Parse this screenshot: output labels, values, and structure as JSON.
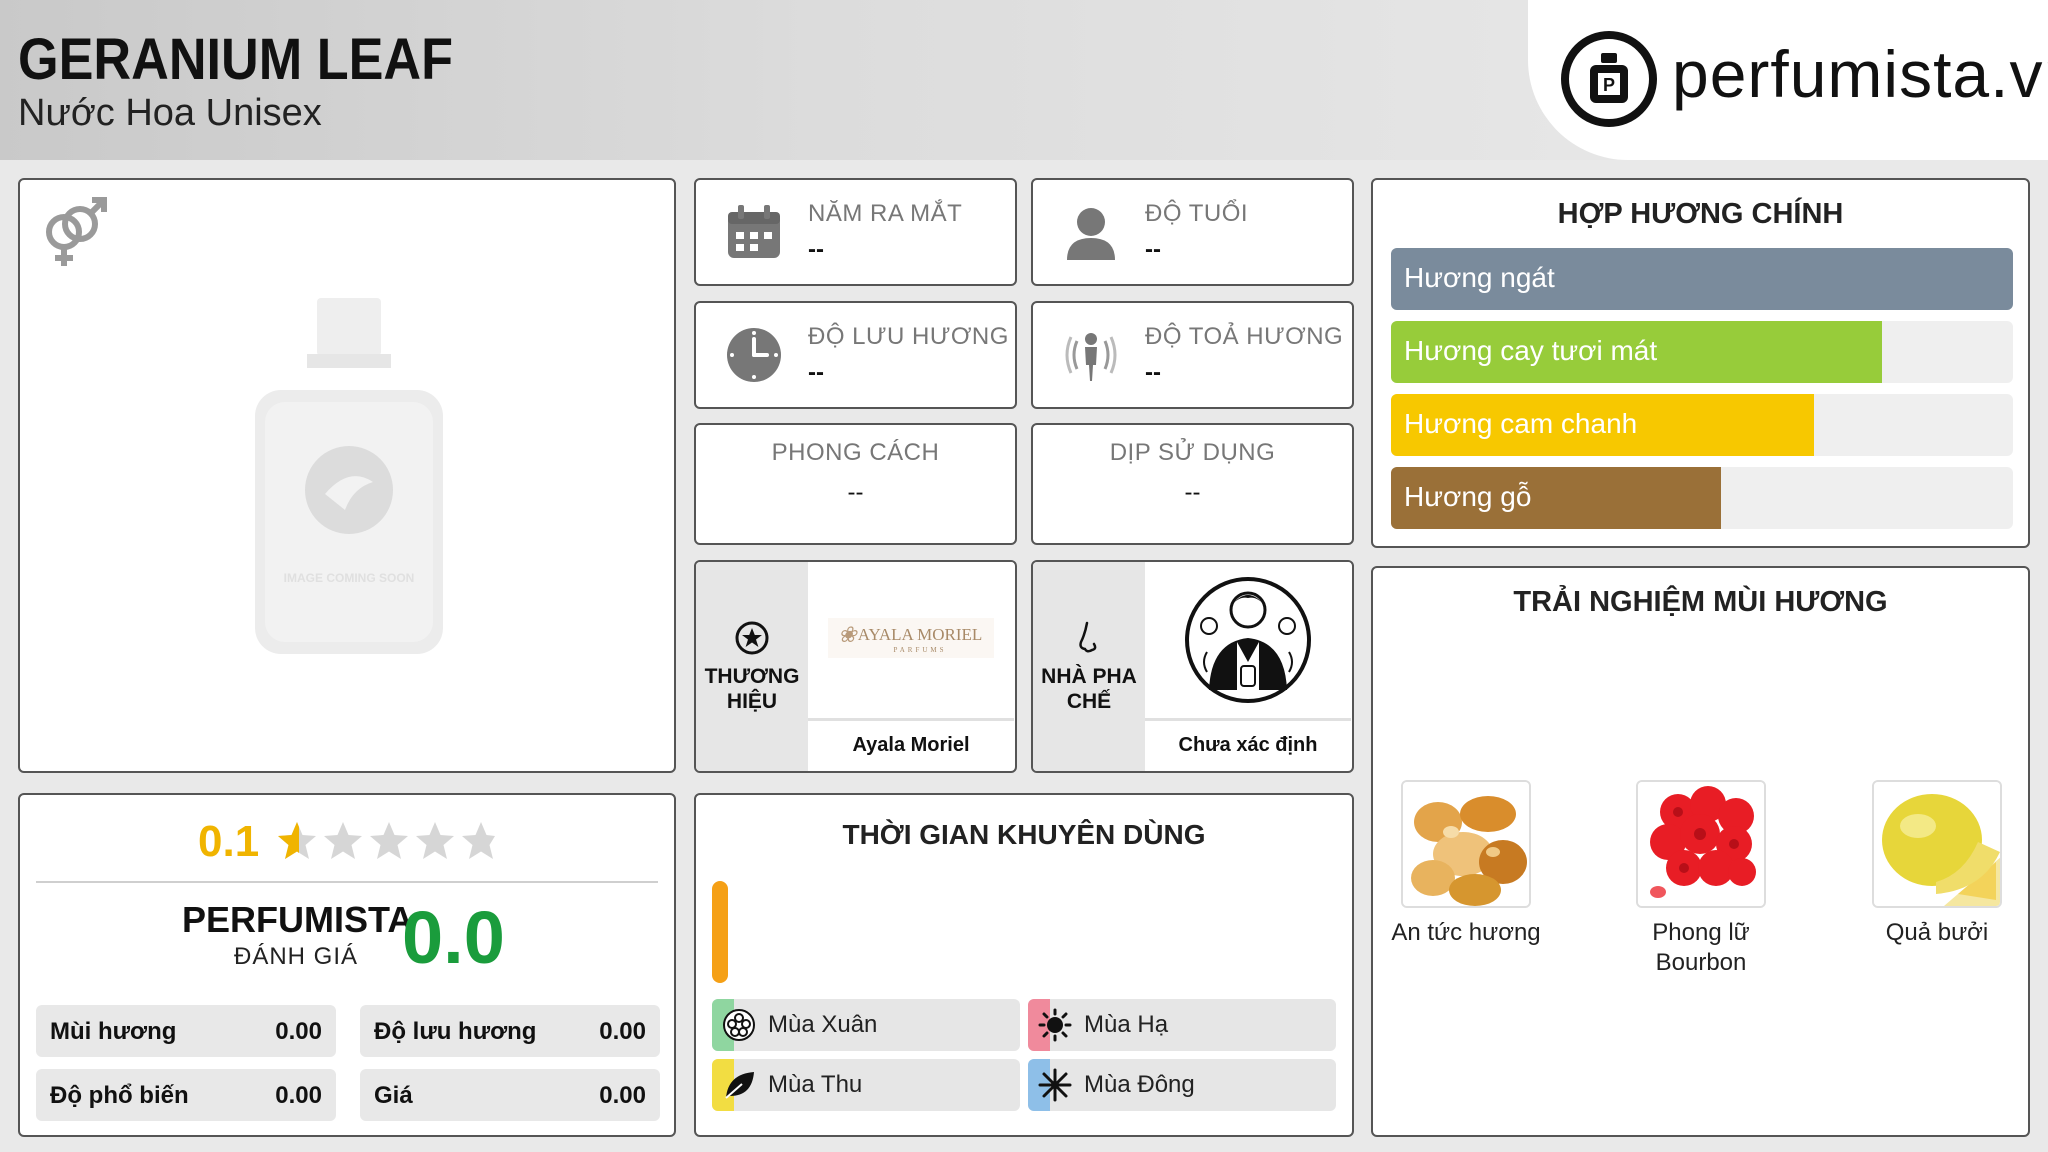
{
  "header": {
    "title": "GERANIUM LEAF",
    "subtitle": "Nước Hoa Unisex",
    "logo_text": "perfumista.vn"
  },
  "image_panel": {
    "gender_icon": "male-female-icon",
    "placeholder_text": "IMAGE COMING SOON"
  },
  "info": {
    "release_year": {
      "label": "NĂM RA MẮT",
      "value": "--",
      "icon": "calendar-icon"
    },
    "age": {
      "label": "ĐỘ TUỔI",
      "value": "--",
      "icon": "person-icon"
    },
    "longevity": {
      "label": "ĐỘ LƯU HƯƠNG",
      "value": "--",
      "icon": "clock-icon"
    },
    "sillage": {
      "label": "ĐỘ TOẢ HƯƠNG",
      "value": "--",
      "icon": "diffusion-icon"
    },
    "style": {
      "label": "PHONG CÁCH",
      "value": "--"
    },
    "occasion": {
      "label": "DỊP SỬ DỤNG",
      "value": "--"
    }
  },
  "brand": {
    "side_label": "THƯƠNG HIỆU",
    "name": "Ayala Moriel",
    "logo_text": "AYALA MORIEL",
    "logo_sub": "PARFUMS"
  },
  "perfumer": {
    "side_label": "NHÀ PHA CHẾ",
    "name": "Chưa xác định"
  },
  "rating": {
    "user_score": "0.1",
    "stars": 5,
    "brand_label": "PERFUMISTA",
    "brand_sub": "ĐÁNH GIÁ",
    "perfumista_score": "0.0",
    "metrics": [
      {
        "label": "Mùi hương",
        "value": "0.00"
      },
      {
        "label": "Độ lưu hương",
        "value": "0.00"
      },
      {
        "label": "Độ phổ biến",
        "value": "0.00"
      },
      {
        "label": "Giá",
        "value": "0.00"
      }
    ]
  },
  "time": {
    "title": "THỜI GIAN KHUYÊN DÙNG",
    "seasons": [
      {
        "label": "Mùa Xuân",
        "icon": "flower-icon",
        "color": "#8fd6a0"
      },
      {
        "label": "Mùa Hạ",
        "icon": "sun-icon",
        "color": "#f08a9c"
      },
      {
        "label": "Mùa Thu",
        "icon": "leaf-icon",
        "color": "#f2dd42"
      },
      {
        "label": "Mùa Đông",
        "icon": "snowflake-icon",
        "color": "#8ebfe8"
      }
    ]
  },
  "accords": {
    "title": "HỢP HƯƠNG CHÍNH",
    "items": [
      {
        "label": "Hương ngát",
        "percent": 100,
        "color": "#7a8b9c"
      },
      {
        "label": "Hương cay tươi mát",
        "percent": 79,
        "color": "#97cc3a"
      },
      {
        "label": "Hương cam chanh",
        "percent": 68,
        "color": "#f7c800"
      },
      {
        "label": "Hương gỗ",
        "percent": 53,
        "color": "#9a7038"
      }
    ]
  },
  "experience": {
    "title": "TRẢI NGHIỆM MÙI HƯƠNG",
    "notes": [
      {
        "label": "An tức hương",
        "image": "resin-image"
      },
      {
        "label": "Phong lữ Bourbon",
        "image": "geranium-image"
      },
      {
        "label": "Quả bưởi",
        "image": "grapefruit-image"
      }
    ]
  }
}
